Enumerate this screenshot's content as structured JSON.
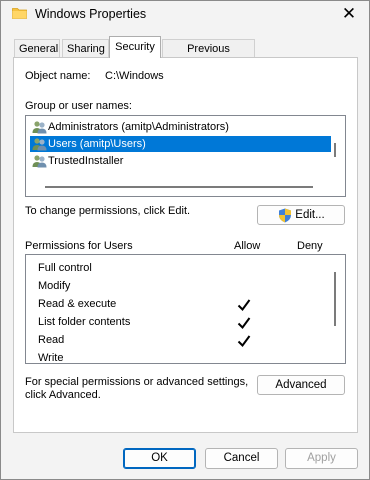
{
  "window": {
    "title": "Windows Properties",
    "close_glyph": "✕"
  },
  "tabs": [
    {
      "label": "General"
    },
    {
      "label": "Sharing"
    },
    {
      "label": "Security"
    },
    {
      "label": "Previous Versions"
    }
  ],
  "security": {
    "object_name_label": "Object name:",
    "object_name_value": "C:\\Windows",
    "group_label": "Group or user names:",
    "users": [
      {
        "name": "Administrators (amitp\\Administrators)",
        "icon": "users-icon"
      },
      {
        "name": "Users (amitp\\Users)",
        "icon": "users-icon"
      },
      {
        "name": "TrustedInstaller",
        "icon": "users-icon"
      }
    ],
    "change_text": "To change permissions, click Edit.",
    "edit_button": "Edit...",
    "permissions_label": "Permissions for Users",
    "allow_header": "Allow",
    "deny_header": "Deny",
    "permissions": [
      {
        "name": "Full control",
        "allow": false,
        "deny": false
      },
      {
        "name": "Modify",
        "allow": false,
        "deny": false
      },
      {
        "name": "Read & execute",
        "allow": true,
        "deny": false
      },
      {
        "name": "List folder contents",
        "allow": true,
        "deny": false
      },
      {
        "name": "Read",
        "allow": true,
        "deny": false
      },
      {
        "name": "Write",
        "allow": false,
        "deny": false
      }
    ],
    "special_text_line1": "For special permissions or advanced settings,",
    "special_text_line2": "click Advanced.",
    "advanced_button": "Advanced"
  },
  "footer": {
    "ok": "OK",
    "cancel": "Cancel",
    "apply": "Apply"
  },
  "colors": {
    "selection": "#0078d7",
    "accent": "#0067c0"
  }
}
